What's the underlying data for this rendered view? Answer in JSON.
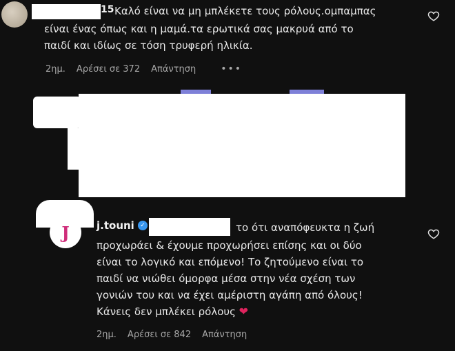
{
  "comment1": {
    "username_fragment": "15",
    "line1": "Καλό είναι να μη μπλέκετε τους ρόλους.ομπαμπας",
    "line2": "είναι ένας όπως και η μαμά.τα ερωτικά σας μακρυά από το",
    "line3": "παιδί και ιδίως σε τόση τρυφερή ηλικία.",
    "time": "2ημ.",
    "likes": "Αρέσει σε 372",
    "reply": "Απάντηση",
    "more": "•••"
  },
  "comment2": {
    "avatar_letter": "J",
    "username": "j.touni",
    "line1": "το ότι αναπόφευκτα η ζωή",
    "line2": "προχωράει & έχουμε προχωρήσει επίσης και οι δύο",
    "line3": "είναι το λογικό και επόμενο! Το ζητούμενο είναι το",
    "line4": "παιδί να νιώθει όμορφα μέσα στην νέα σχέση των",
    "line5": "γονιών του και να έχει αμέριστη αγάπη από όλους!",
    "line6": "Κάνεις δεν μπλέκει ρόλους",
    "emoji": "❤",
    "time": "2ημ.",
    "likes": "Αρέσει σε 842",
    "reply": "Απάντηση"
  },
  "icons": {
    "heart": "heart-outline-icon",
    "verified": "verified-badge-icon",
    "more": "more-dots-icon"
  },
  "colors": {
    "background": "#101010",
    "meta_text": "#a8a8a8",
    "verified_blue": "#3897f0",
    "emoji_red": "#e0245e"
  }
}
